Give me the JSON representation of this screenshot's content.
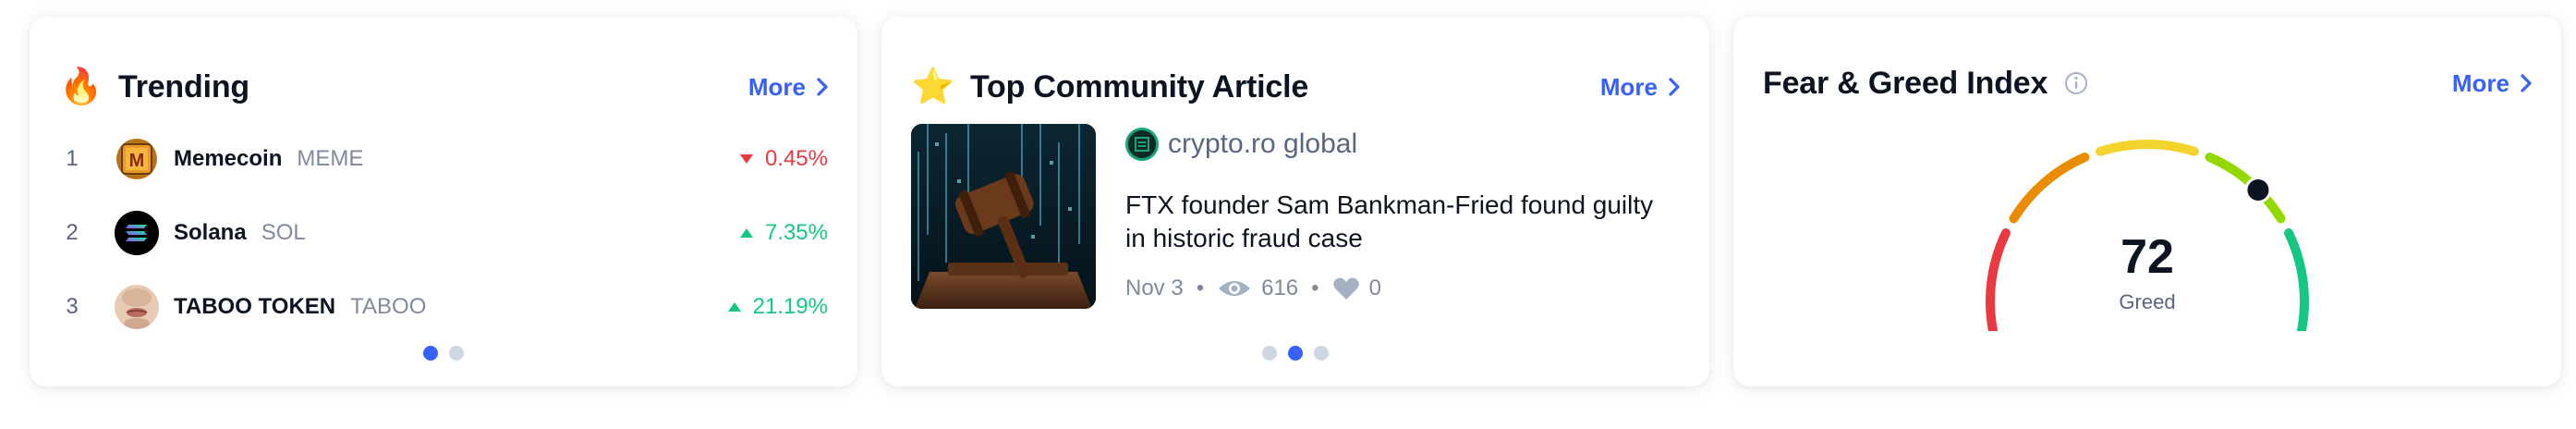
{
  "trending": {
    "emoji": "🔥",
    "title": "Trending",
    "more_label": "More",
    "coins": [
      {
        "rank": "1",
        "name": "Memecoin",
        "symbol": "MEME",
        "change": "0.45%",
        "direction": "down",
        "logo": "memecoin-logo"
      },
      {
        "rank": "2",
        "name": "Solana",
        "symbol": "SOL",
        "change": "7.35%",
        "direction": "up",
        "logo": "solana-logo"
      },
      {
        "rank": "3",
        "name": "TABOO TOKEN",
        "symbol": "TABOO",
        "change": "21.19%",
        "direction": "up",
        "logo": "taboo-logo"
      }
    ],
    "page_count": 2,
    "active_page": 1
  },
  "article": {
    "emoji": "⭐",
    "title": "Top Community Article",
    "more_label": "More",
    "source": "crypto.ro global",
    "headline": "FTX founder Sam Bankman-Fried found guilty in historic fraud case",
    "date": "Nov 3",
    "views": "616",
    "likes": "0",
    "page_count": 3,
    "active_page": 2
  },
  "fear_greed": {
    "title": "Fear & Greed Index",
    "more_label": "More",
    "value": "72",
    "label": "Greed",
    "level": 72
  },
  "colors": {
    "accent": "#3861fb",
    "negative": "#ea3943",
    "positive": "#16c784",
    "text_primary": "#0d1421",
    "text_secondary": "#58667e",
    "text_muted": "#808a9d"
  }
}
